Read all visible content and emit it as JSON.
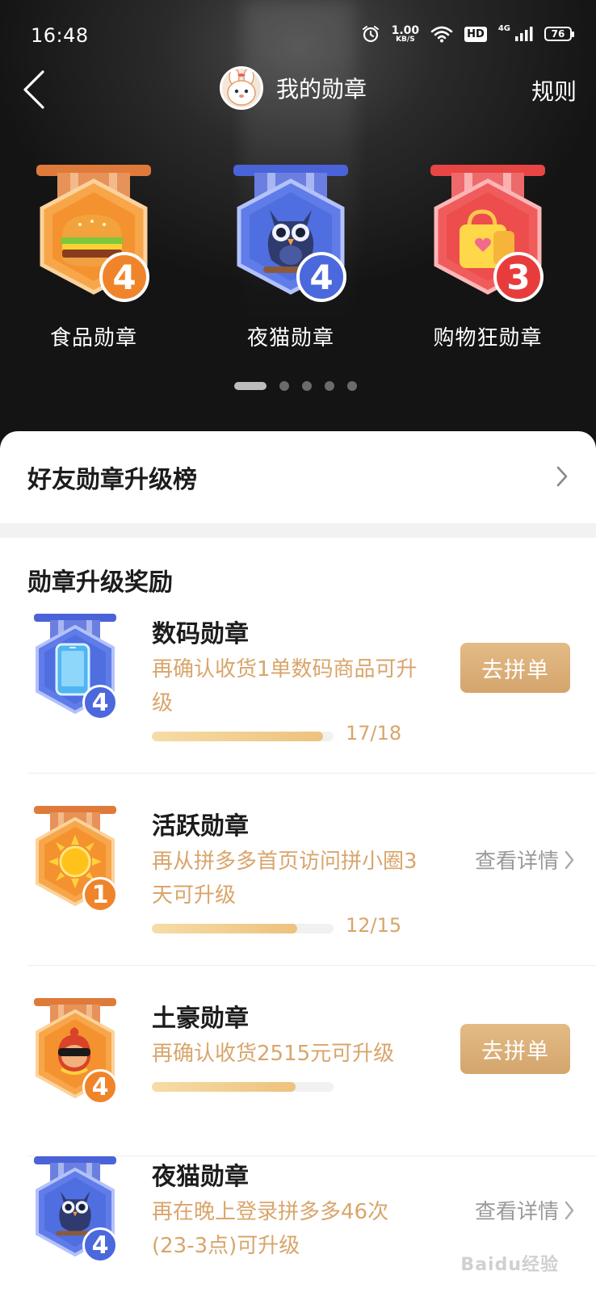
{
  "status_bar": {
    "time": "16:48",
    "net_speed_value": "1.00",
    "net_speed_unit": "KB/S",
    "hd": "HD",
    "signal_type": "4G",
    "battery": "76"
  },
  "header": {
    "title": "我的勋章",
    "rules": "规则"
  },
  "carousel": {
    "medals": [
      {
        "label": "食品勋章",
        "level": "4",
        "theme": "orange",
        "icon": "burger-icon"
      },
      {
        "label": "夜猫勋章",
        "level": "4",
        "theme": "blue",
        "icon": "owl-icon"
      },
      {
        "label": "购物狂勋章",
        "level": "3",
        "theme": "red",
        "icon": "shopping-bag-icon"
      }
    ],
    "page_count": 5,
    "active_page": 1
  },
  "friend_rank": {
    "title": "好友勋章升级榜"
  },
  "section": {
    "title": "勋章升级奖励"
  },
  "rewards": [
    {
      "name": "数码勋章",
      "desc": "再确认收货1单数码商品可升级",
      "level": "4",
      "theme": "blue",
      "icon": "phone-icon",
      "progress_text": "17/18",
      "progress": 0.94,
      "action_type": "button",
      "action_label": "去拼单"
    },
    {
      "name": "活跃勋章",
      "desc": "再从拼多多首页访问拼小圈3天可升级",
      "level": "1",
      "theme": "orange",
      "icon": "sun-icon",
      "progress_text": "12/15",
      "progress": 0.8,
      "action_type": "link",
      "action_label": "查看详情"
    },
    {
      "name": "土豪勋章",
      "desc": "再确认收货2515元可升级",
      "level": "4",
      "theme": "orange",
      "icon": "rich-man-icon",
      "progress_text": "",
      "progress": 0.79,
      "action_type": "button",
      "action_label": "去拼单"
    },
    {
      "name": "夜猫勋章",
      "desc": "再在晚上登录拼多多46次(23-3点)可升级",
      "level": "4",
      "theme": "blue",
      "icon": "owl-icon",
      "progress_text": "",
      "progress": 0,
      "action_type": "link",
      "action_label": "查看详情"
    }
  ],
  "watermark": "Baidu经验",
  "colors": {
    "accent_gold": "#d9a56b",
    "button_gold": "#d4a56d",
    "medal_orange": "#f09a3c",
    "medal_blue": "#4f6ee0",
    "medal_red": "#ee4d4d"
  }
}
